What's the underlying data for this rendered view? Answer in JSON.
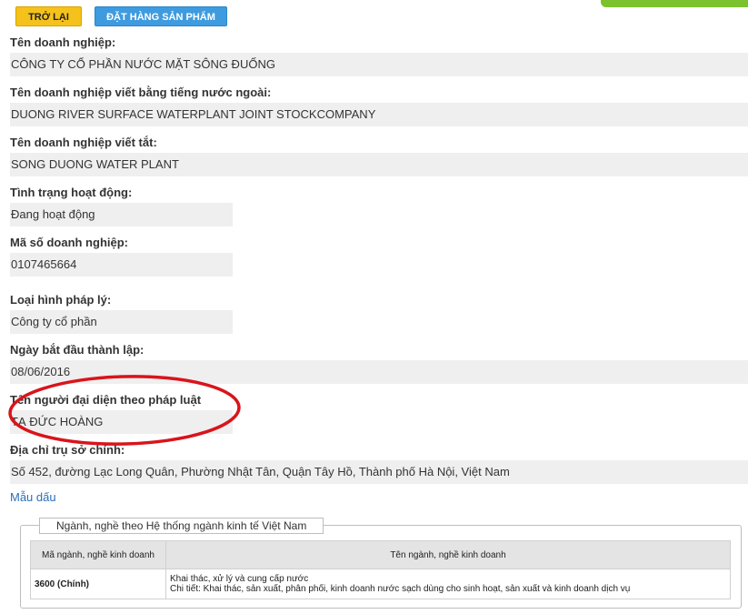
{
  "buttons": {
    "back_label": "TRỞ LẠI",
    "order_label": "ĐẶT HÀNG SẢN PHẨM"
  },
  "fields": [
    {
      "label": "Tên doanh nghiệp:",
      "value": "CÔNG TY CỔ PHẦN NƯỚC MẶT SÔNG ĐUỐNG"
    },
    {
      "label": "Tên doanh nghiệp viết bằng tiếng nước ngoài:",
      "value": "DUONG RIVER SURFACE WATERPLANT JOINT STOCKCOMPANY"
    },
    {
      "label": "Tên doanh nghiệp viết tắt:",
      "value": "SONG DUONG WATER PLANT"
    },
    {
      "label": "Tình trạng hoạt động:",
      "value": "Đang hoạt động"
    },
    {
      "label": "Mã số doanh nghiệp:",
      "value": "0107465664"
    },
    {
      "label": "Loại hình pháp lý:",
      "value": "Công ty cổ phần"
    },
    {
      "label": "Ngày bắt đầu thành lập:",
      "value": "08/06/2016"
    },
    {
      "label": "Tên người đại diện theo pháp luật",
      "value": "TẠ ĐỨC HOÀNG"
    },
    {
      "label": "Địa chỉ trụ sở chính:",
      "value": "Số 452, đường Lạc Long Quân, Phường Nhật Tân, Quận Tây Hồ, Thành phố Hà Nội, Việt Nam"
    }
  ],
  "seal_link": "Mẫu dấu",
  "industry": {
    "legend": "Ngành, nghề theo Hệ thống ngành kinh tế Việt Nam",
    "headers": {
      "code": "Mã ngành, nghề kinh doanh",
      "name": "Tên ngành, nghề kinh doanh"
    },
    "rows": [
      {
        "code": "3600 (Chính)",
        "name_line1": "Khai thác, xử lý và cung cấp nước",
        "name_line2": "Chi tiết: Khai thác, sản xuất, phân phối, kinh doanh nước sạch dùng cho sinh hoạt, sản xuất và kinh doanh dịch vụ"
      }
    ]
  },
  "colors": {
    "accent_green": "#7cc22d",
    "back_button": "#f5c21b",
    "order_button": "#3e9be0",
    "highlight_oval": "#d9141b",
    "value_bg": "#efefef"
  }
}
